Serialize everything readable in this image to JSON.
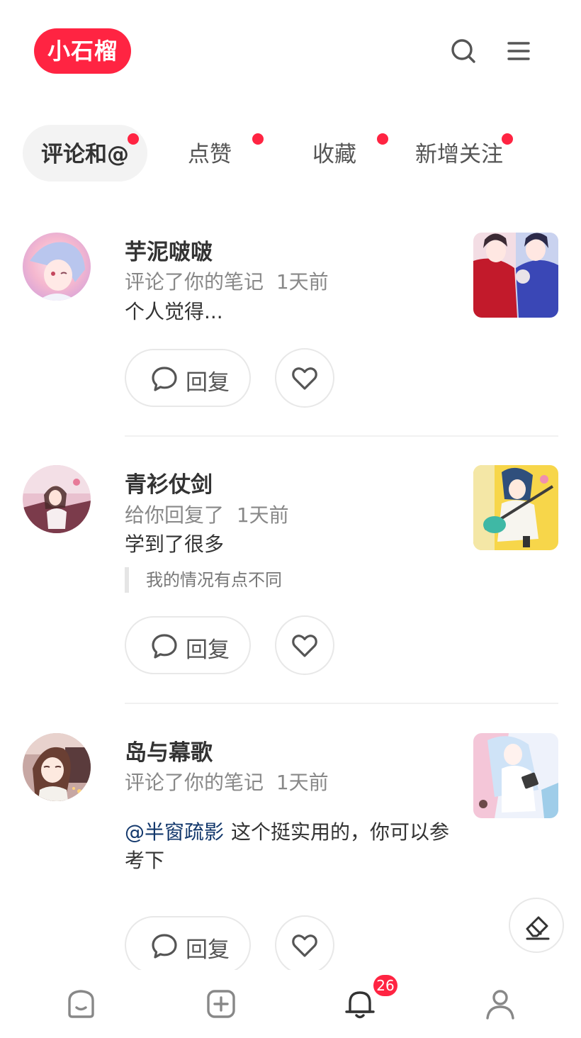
{
  "header": {
    "logo_text": "小石榴",
    "brand_color": "#ff2442",
    "icons": [
      "search-icon",
      "menu-icon"
    ]
  },
  "tabs": [
    {
      "label": "评论和@",
      "active": true,
      "has_dot": true
    },
    {
      "label": "点赞",
      "active": false,
      "has_dot": true
    },
    {
      "label": "收藏",
      "active": false,
      "has_dot": true
    },
    {
      "label": "新增关注",
      "active": false,
      "has_dot": true
    }
  ],
  "notifications": [
    {
      "username": "芋泥啵啵",
      "action": "评论了你的笔记",
      "time": "1天前",
      "content": "个人觉得...",
      "reply_label": "回复"
    },
    {
      "username": "青衫仗剑",
      "action": "给你回复了",
      "time": "1天前",
      "content": "学到了很多",
      "quote": "我的情况有点不同",
      "reply_label": "回复"
    },
    {
      "username": "岛与幕歌",
      "action": "评论了你的笔记",
      "time": "1天前",
      "mention": "@半窗疏影",
      "content": "这个挺实用的，你可以参考下",
      "reply_label": "回复"
    }
  ],
  "bottom_nav": {
    "items": [
      "home-icon",
      "add-icon",
      "bell-icon",
      "user-icon"
    ],
    "badge": "26",
    "active": "bell-icon"
  }
}
